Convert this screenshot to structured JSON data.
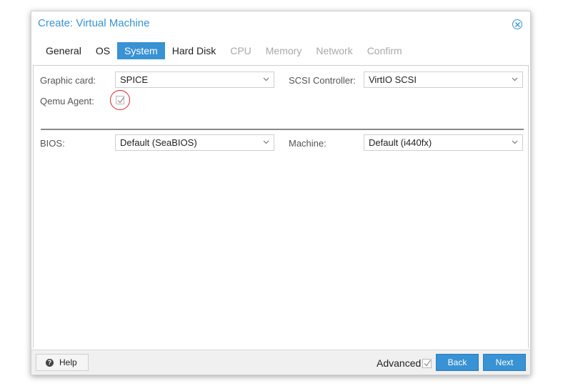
{
  "dialog": {
    "title": "Create: Virtual Machine"
  },
  "tabs": [
    {
      "label": "General",
      "state": "normal"
    },
    {
      "label": "OS",
      "state": "normal"
    },
    {
      "label": "System",
      "state": "active"
    },
    {
      "label": "Hard Disk",
      "state": "normal"
    },
    {
      "label": "CPU",
      "state": "disabled"
    },
    {
      "label": "Memory",
      "state": "disabled"
    },
    {
      "label": "Network",
      "state": "disabled"
    },
    {
      "label": "Confirm",
      "state": "disabled"
    }
  ],
  "form": {
    "graphic_card": {
      "label": "Graphic card:",
      "value": "SPICE"
    },
    "scsi_controller": {
      "label": "SCSI Controller:",
      "value": "VirtIO SCSI"
    },
    "qemu_agent": {
      "label": "Qemu Agent:",
      "checked": true
    },
    "bios": {
      "label": "BIOS:",
      "value": "Default (SeaBIOS)"
    },
    "machine": {
      "label": "Machine:",
      "value": "Default (i440fx)"
    }
  },
  "footer": {
    "help_label": "Help",
    "advanced_label": "Advanced",
    "advanced_checked": true,
    "back_label": "Back",
    "next_label": "Next"
  },
  "colors": {
    "accent": "#3892d4",
    "highlight_ring": "#e02424"
  }
}
